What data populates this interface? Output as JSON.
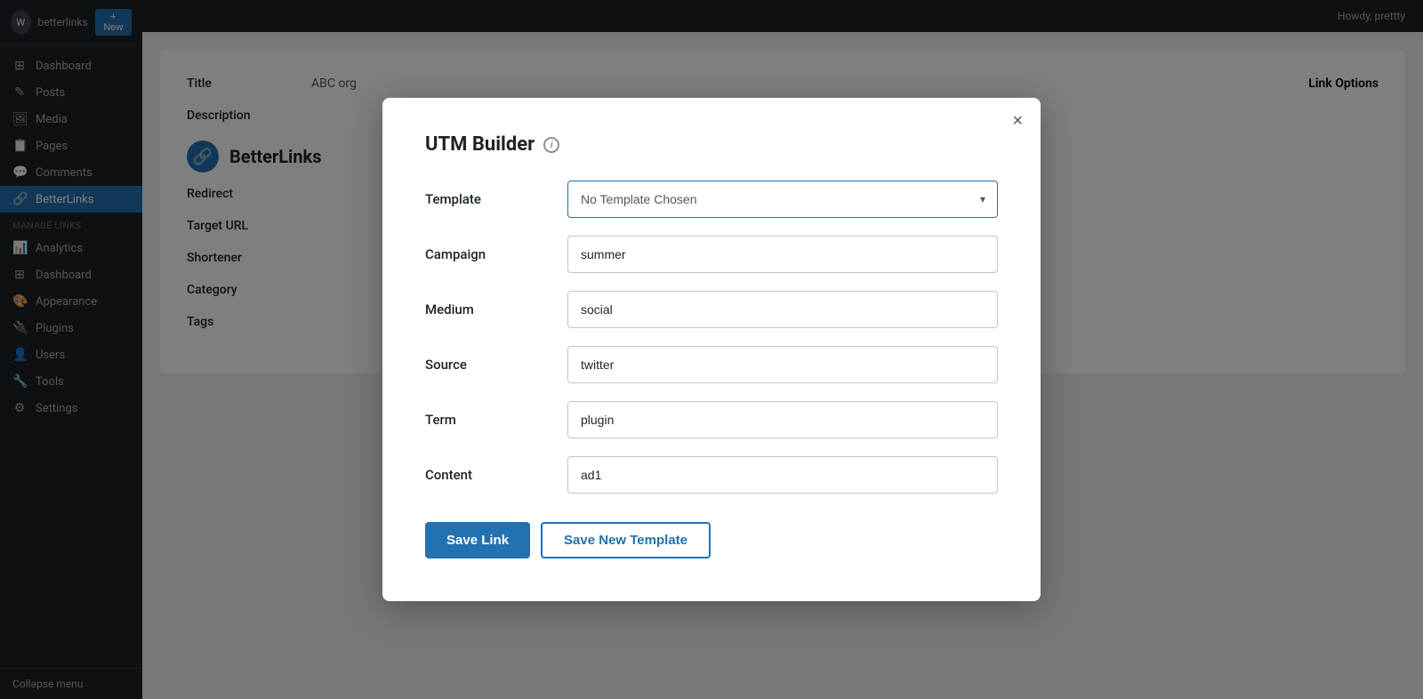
{
  "sidebar": {
    "site_name": "betterlinks",
    "new_button": "+ New",
    "items": [
      {
        "id": "dashboard",
        "label": "Dashboard",
        "icon": "⊞",
        "active": false
      },
      {
        "id": "posts",
        "label": "Posts",
        "icon": "📄",
        "active": false
      },
      {
        "id": "media",
        "label": "Media",
        "icon": "🖼",
        "active": false
      },
      {
        "id": "pages",
        "label": "Pages",
        "icon": "📋",
        "active": false
      },
      {
        "id": "comments",
        "label": "Comments",
        "icon": "💬",
        "active": false
      },
      {
        "id": "betterlinks",
        "label": "BetterLinks",
        "icon": "🔗",
        "active": true
      }
    ],
    "manage_links_section": "Manage Links",
    "manage_items": [
      {
        "id": "analytics",
        "label": "Analytics"
      },
      {
        "id": "dashboard2",
        "label": "Dashboard"
      }
    ],
    "appearance": "Appearance",
    "plugins": "Plugins",
    "users": "Users",
    "tools": "Tools",
    "settings": "Settings",
    "collapse": "Collapse menu"
  },
  "topbar": {
    "user": "Howdy, prettty"
  },
  "background": {
    "title_label": "Title",
    "title_value": "ABC org",
    "link_options": "Link Options",
    "description_label": "Description",
    "redirect_label": "Redirect",
    "target_url_label": "Target URL",
    "shortener_label": "Shortener",
    "category_label": "Category",
    "tags_label": "Tags",
    "bl_brand": "BetterLinks"
  },
  "modal": {
    "title": "UTM Builder",
    "info_icon": "i",
    "close_icon": "×",
    "template_label": "Template",
    "template_placeholder": "No Template Chosen",
    "template_options": [
      "No Template Chosen"
    ],
    "campaign_label": "Campaign",
    "campaign_value": "summer",
    "medium_label": "Medium",
    "medium_value": "social",
    "source_label": "Source",
    "source_value": "twitter",
    "term_label": "Term",
    "term_value": "plugin",
    "content_label": "Content",
    "content_value": "ad1",
    "save_link_label": "Save Link",
    "save_template_label": "Save New Template"
  },
  "colors": {
    "primary": "#2271b1",
    "sidebar_bg": "#1d2327",
    "active_nav": "#2271b1"
  }
}
